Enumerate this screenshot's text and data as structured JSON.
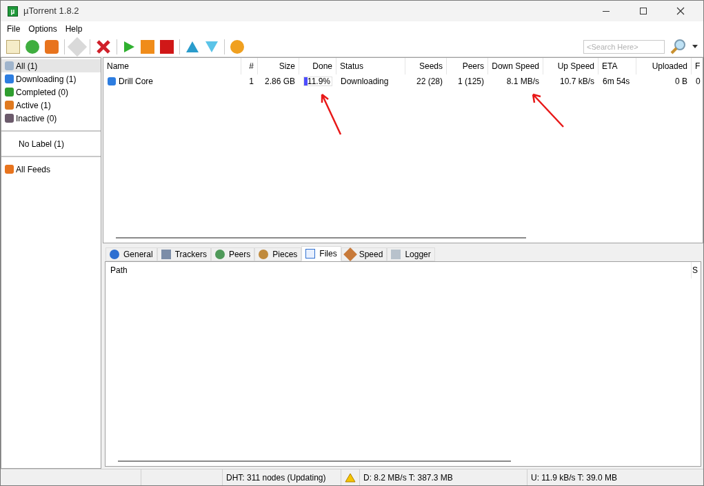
{
  "window": {
    "title": "µTorrent 1.8.2",
    "logo": "µ"
  },
  "menu": [
    "File",
    "Options",
    "Help"
  ],
  "search": {
    "placeholder": "<Search Here>"
  },
  "sidebar": {
    "groups": [
      {
        "items": [
          {
            "label": "All (1)",
            "kind": "all",
            "selected": true
          },
          {
            "label": "Downloading (1)",
            "kind": "down",
            "selected": false
          },
          {
            "label": "Completed (0)",
            "kind": "done",
            "selected": false
          },
          {
            "label": "Active (1)",
            "kind": "active",
            "selected": false
          },
          {
            "label": "Inactive (0)",
            "kind": "inactive",
            "selected": false
          }
        ]
      },
      {
        "items": [
          {
            "label": "No Label (1)",
            "kind": "label",
            "selected": false
          }
        ]
      },
      {
        "items": [
          {
            "label": "All Feeds",
            "kind": "feed",
            "selected": false
          }
        ]
      }
    ]
  },
  "table": {
    "columns": [
      "Name",
      "#",
      "Size",
      "Done",
      "Status",
      "Seeds",
      "Peers",
      "Down Speed",
      "Up Speed",
      "ETA",
      "Uploaded",
      "F"
    ],
    "rows": [
      {
        "cells": [
          "Drill Core",
          "1",
          "2.86 GB",
          "11.9%",
          "Downloading",
          "22 (28)",
          "1 (125)",
          "8.1 MB/s",
          "10.7 kB/s",
          "6m 54s",
          "0 B",
          "0"
        ],
        "level": 0.119,
        "selected": false
      }
    ]
  },
  "tabs": [
    {
      "label": "General",
      "selected": false
    },
    {
      "label": "Trackers",
      "selected": false
    },
    {
      "label": "Peers",
      "selected": false
    },
    {
      "label": "Pieces",
      "selected": false
    },
    {
      "label": "Files",
      "selected": true
    },
    {
      "label": "Speed",
      "selected": false
    },
    {
      "label": "Logger",
      "selected": false
    }
  ],
  "files": {
    "columns": [
      "Path",
      "S"
    ]
  },
  "status_bar": {
    "dht": "DHT: 311 nodes (Updating)",
    "download": "D: 8.2 MB/s T: 387.3 MB",
    "upload": "U: 11.9 kB/s T: 39.0 MB"
  }
}
